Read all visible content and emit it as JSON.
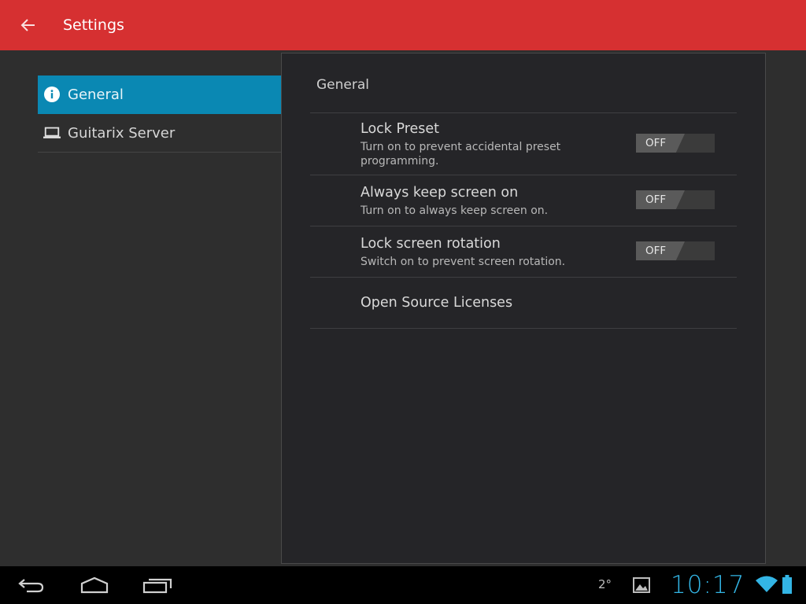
{
  "appbar": {
    "title": "Settings",
    "back_icon": "arrow-left-icon",
    "color": "#d63031"
  },
  "headers": [
    {
      "label": "General",
      "icon": "info-icon",
      "active": true
    },
    {
      "label": "Guitarix Server",
      "icon": "laptop-icon",
      "active": false
    }
  ],
  "panel": {
    "title": "General",
    "prefs": [
      {
        "title": "Lock Preset",
        "summary": "Turn on to prevent accidental preset programming.",
        "toggle": "OFF"
      },
      {
        "title": "Always keep screen on",
        "summary": "Turn on to always keep screen on.",
        "toggle": "OFF"
      },
      {
        "title": "Lock screen rotation",
        "summary": "Switch on to prevent screen rotation.",
        "toggle": "OFF"
      },
      {
        "title": "Open Source Licenses"
      }
    ]
  },
  "system_bar": {
    "back_icon": "back-nav-icon",
    "home_icon": "home-nav-icon",
    "recents_icon": "recents-nav-icon",
    "temperature": "2°",
    "gallery_icon": "image-notification-icon",
    "clock": "10:17",
    "wifi_icon": "wifi-icon",
    "battery_icon": "battery-icon",
    "accent": "#33b5e5"
  }
}
